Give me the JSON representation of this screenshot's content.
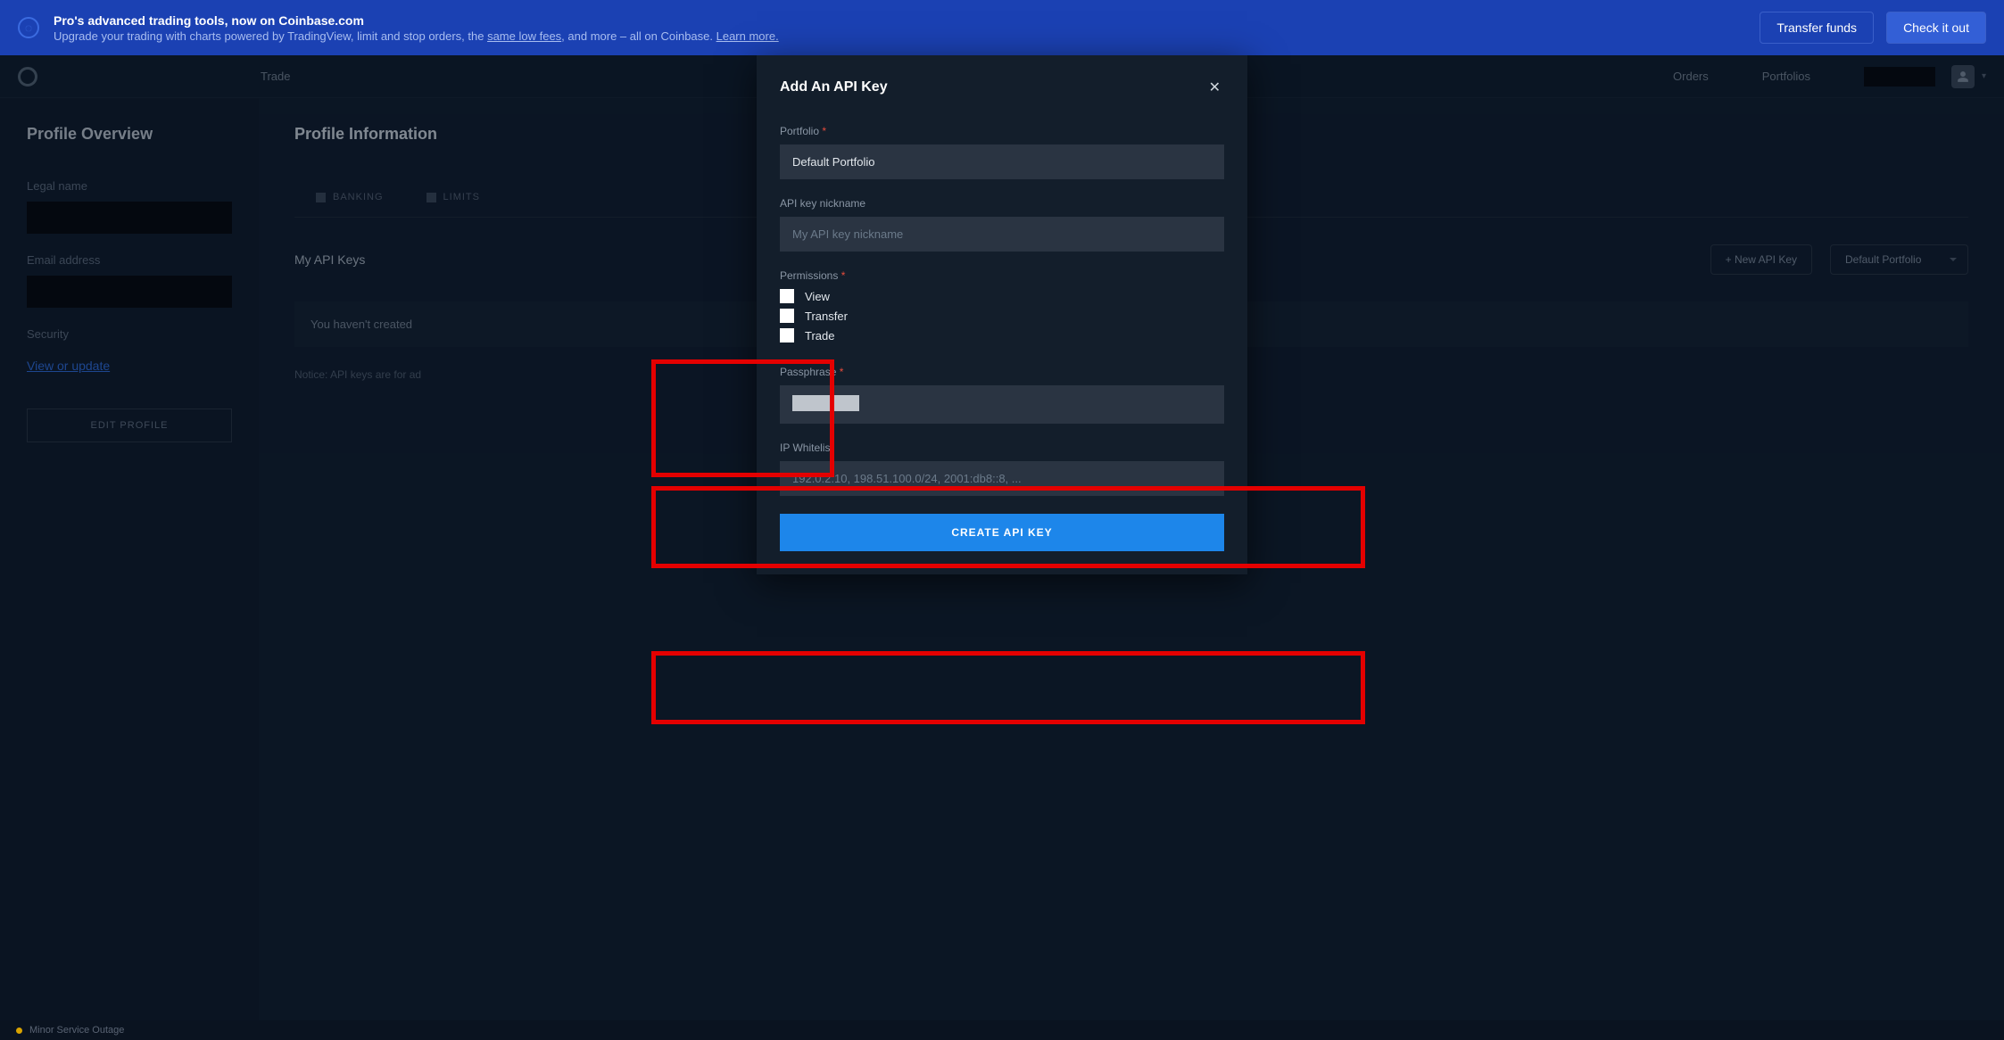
{
  "banner": {
    "title": "Pro's advanced trading tools, now on Coinbase.com",
    "subtitle_prefix": "Upgrade your trading with charts powered by TradingView, limit and stop orders, the ",
    "subtitle_link1": "same low fees",
    "subtitle_mid": ", and more – all on Coinbase. ",
    "subtitle_link2": "Learn more.",
    "transfer_btn": "Transfer funds",
    "check_btn": "Check it out"
  },
  "topnav": {
    "trade": "Trade",
    "orders": "Orders",
    "portfolios": "Portfolios"
  },
  "sidebar": {
    "heading": "Profile Overview",
    "legal_name_label": "Legal name",
    "email_label": "Email address",
    "security_label": "Security",
    "security_link": "View or update",
    "edit_btn": "EDIT PROFILE"
  },
  "content": {
    "heading": "Profile Information",
    "tabs": {
      "banking": "BANKING",
      "limits": "LIMITS"
    },
    "section_title": "My API Keys",
    "new_key_btn": "+ New API Key",
    "portfolio_selected": "Default Portfolio",
    "notice_box": "You haven't created",
    "notice_text": "Notice: API keys are for ad"
  },
  "modal": {
    "title": "Add An API Key",
    "portfolio_label": "Portfolio",
    "portfolio_value": "Default Portfolio",
    "nickname_label": "API key nickname",
    "nickname_placeholder": "My API key nickname",
    "permissions_label": "Permissions",
    "perm_view": "View",
    "perm_transfer": "Transfer",
    "perm_trade": "Trade",
    "passphrase_label": "Passphrase",
    "ip_label": "IP Whitelist",
    "ip_placeholder": "192.0.2.10, 198.51.100.0/24, 2001:db8::8, ...",
    "create_btn": "CREATE API KEY"
  },
  "footer": {
    "status": "Minor Service Outage"
  }
}
